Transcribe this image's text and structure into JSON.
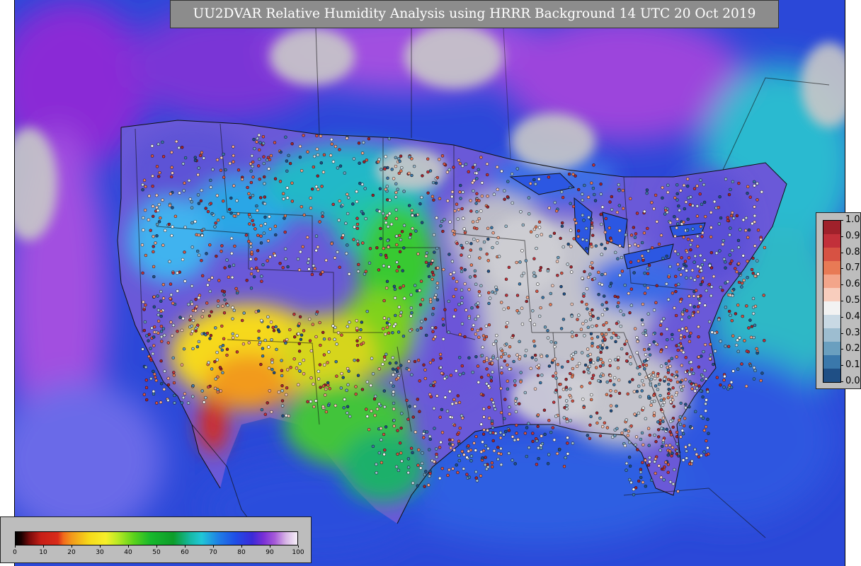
{
  "title": "UU2DVAR Relative Humidity Analysis using HRRR Background 14 UTC 20 Oct 2019",
  "right_colorbar": {
    "labels": [
      "1.0",
      "0.9",
      "0.8",
      "0.7",
      "0.6",
      "0.5",
      "0.4",
      "0.3",
      "0.2",
      "0.1",
      "0.0"
    ],
    "colors": [
      "#a0212b",
      "#c2303a",
      "#d75243",
      "#e87a55",
      "#f3a58a",
      "#f8cdbd",
      "#f2f2f2",
      "#c9d9e4",
      "#9dbdd0",
      "#6a9fbf",
      "#3a78ab",
      "#1f4f85"
    ]
  },
  "bottom_colorbar": {
    "labels": [
      "0",
      "10",
      "20",
      "30",
      "40",
      "50",
      "60",
      "70",
      "80",
      "90",
      "100"
    ]
  },
  "colors": {
    "land_background": "#c8c8c8",
    "ocean_blue": "#2a4be0",
    "purple": "#8a2bd6",
    "dry_yellow": "#f6d91a",
    "dry_orange": "#f29a1c",
    "green": "#22c23a",
    "cyan": "#22c9d6"
  }
}
